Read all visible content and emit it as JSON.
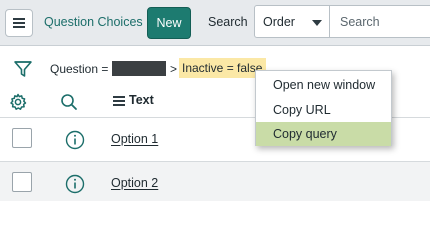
{
  "header": {
    "list_title": "Question Choices",
    "new_label": "New",
    "search_label": "Search",
    "search_field_selected": "Order",
    "search_placeholder": "Search"
  },
  "filter": {
    "question_label": "Question =",
    "separator": ">",
    "inactive_condition": "Inactive = false"
  },
  "columns": {
    "text_header": "Text"
  },
  "rows": [
    {
      "text": "Option 1"
    },
    {
      "text": "Option 2"
    }
  ],
  "context_menu": {
    "items": [
      {
        "label": "Open new window"
      },
      {
        "label": "Copy URL"
      },
      {
        "label": "Copy query",
        "highlighted": true
      }
    ]
  },
  "colors": {
    "header_bg": "#e7eaed",
    "title_text": "#1c6e6a",
    "new_button": "#1d7b70",
    "condition_highlight": "#fbe8a6",
    "menu_highlight": "#c9dca7",
    "icon_teal": "#1c6e6a",
    "alt_row": "#f2f3f4"
  },
  "icons": {
    "menu": "hamburger-icon",
    "filter": "funnel-icon",
    "personalize": "gear-icon",
    "column_search": "search-icon",
    "column_menu": "column-menu-icon",
    "row_preview": "info-icon"
  }
}
